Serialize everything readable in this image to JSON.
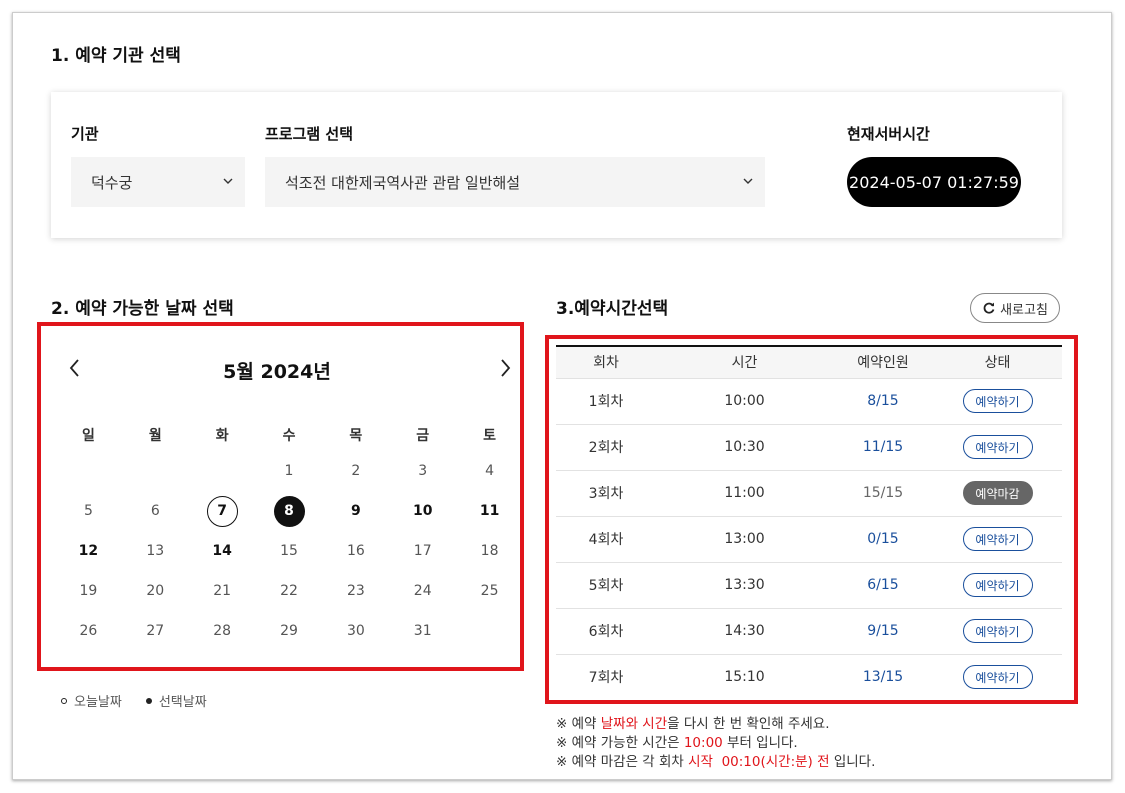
{
  "section1": {
    "title": "1. 예약 기관 선택",
    "institution_label": "기관",
    "institution_value": "덕수궁",
    "program_label": "프로그램 선택",
    "program_value": "석조전 대한제국역사관 관람 일반해설",
    "server_time_label": "현재서버시간",
    "server_time_value": "2024-05-07 01:27:59"
  },
  "section2": {
    "title": "2. 예약 가능한 날짜 선택",
    "month_title": "5월 2024년",
    "weekdays": [
      "일",
      "월",
      "화",
      "수",
      "목",
      "금",
      "토"
    ],
    "weeks": [
      [
        "",
        "",
        "",
        "1",
        "2",
        "3",
        "4"
      ],
      [
        "5",
        "6",
        "7",
        "8",
        "9",
        "10",
        "11"
      ],
      [
        "12",
        "13",
        "14",
        "15",
        "16",
        "17",
        "18"
      ],
      [
        "19",
        "20",
        "21",
        "22",
        "23",
        "24",
        "25"
      ],
      [
        "26",
        "27",
        "28",
        "29",
        "30",
        "31",
        ""
      ]
    ],
    "today": "7",
    "selected": "8",
    "available_bold": [
      "9",
      "10",
      "11",
      "12",
      "14"
    ],
    "legend_today": "오늘날짜",
    "legend_selected": "선택날짜"
  },
  "section3": {
    "title": "3.예약시간선택",
    "refresh_label": "새로고침",
    "columns": [
      "회차",
      "시간",
      "예약인원",
      "상태"
    ],
    "rows": [
      {
        "round": "1회차",
        "time": "10:00",
        "count": "8/15",
        "status": "예약하기",
        "open": true
      },
      {
        "round": "2회차",
        "time": "10:30",
        "count": "11/15",
        "status": "예약하기",
        "open": true
      },
      {
        "round": "3회차",
        "time": "11:00",
        "count": "15/15",
        "status": "예약마감",
        "open": false
      },
      {
        "round": "4회차",
        "time": "13:00",
        "count": "0/15",
        "status": "예약하기",
        "open": true
      },
      {
        "round": "5회차",
        "time": "13:30",
        "count": "6/15",
        "status": "예약하기",
        "open": true
      },
      {
        "round": "6회차",
        "time": "14:30",
        "count": "9/15",
        "status": "예약하기",
        "open": true
      },
      {
        "round": "7회차",
        "time": "15:10",
        "count": "13/15",
        "status": "예약하기",
        "open": true
      }
    ],
    "notes": {
      "n1_pre": "※ 예약 ",
      "n1_hl": "날짜와 시간",
      "n1_post": "을 다시 한 번 확인해 주세요.",
      "n2_pre": "※ 예약 가능한 시간은 ",
      "n2_hl": "10:00",
      "n2_post": " 부터 입니다.",
      "n3_pre": "※ 예약 마감은 각 회차 ",
      "n3_hl": "시작  00:10(시간:분) 전",
      "n3_post": " 입니다."
    }
  },
  "colors": {
    "highlight_red": "#e0151b",
    "link_blue": "#1a4f9c",
    "saturday_blue": "#1a34d6",
    "closed_gray": "#666666"
  }
}
